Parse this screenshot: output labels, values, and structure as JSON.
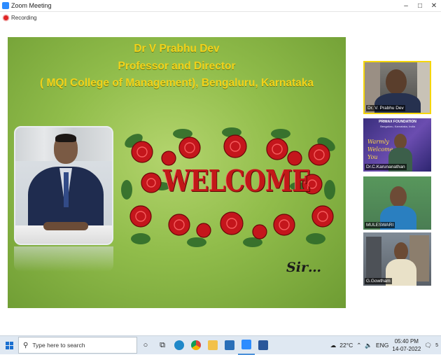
{
  "window": {
    "title": "Zoom Meeting",
    "controls": [
      "–",
      "□",
      "✕"
    ]
  },
  "recording": {
    "label": "Recording"
  },
  "slide": {
    "line1": "Dr V Prabhu Dev",
    "line2": "Professor and Director",
    "line3": "( MQI College of Management), Bengaluru, Karnataka",
    "welcome": "WELCOME",
    "signoff": "Sir…"
  },
  "participants": [
    {
      "name": "Dr. V. Prabhu Dev",
      "active": true
    },
    {
      "name": "Dr.C.Karunanathan",
      "banner_title": "PRIMAX FOUNDATION",
      "banner_sub": "Bengaluru, Karnataka, India",
      "banner_text": "Warmly Welcome You"
    },
    {
      "name": "MULESWARI"
    },
    {
      "name": "G.Gowtham"
    }
  ],
  "taskbar": {
    "search_placeholder": "Type here to search",
    "weather": "22°C",
    "language": "ENG",
    "time": "05:40 PM",
    "date": "14-07-2022",
    "notification_count": "5"
  },
  "colors": {
    "accent": "#2D8CFF",
    "slide_text": "#f2d21a",
    "welcome_red": "#c21818",
    "active_border": "#f5d60a"
  }
}
